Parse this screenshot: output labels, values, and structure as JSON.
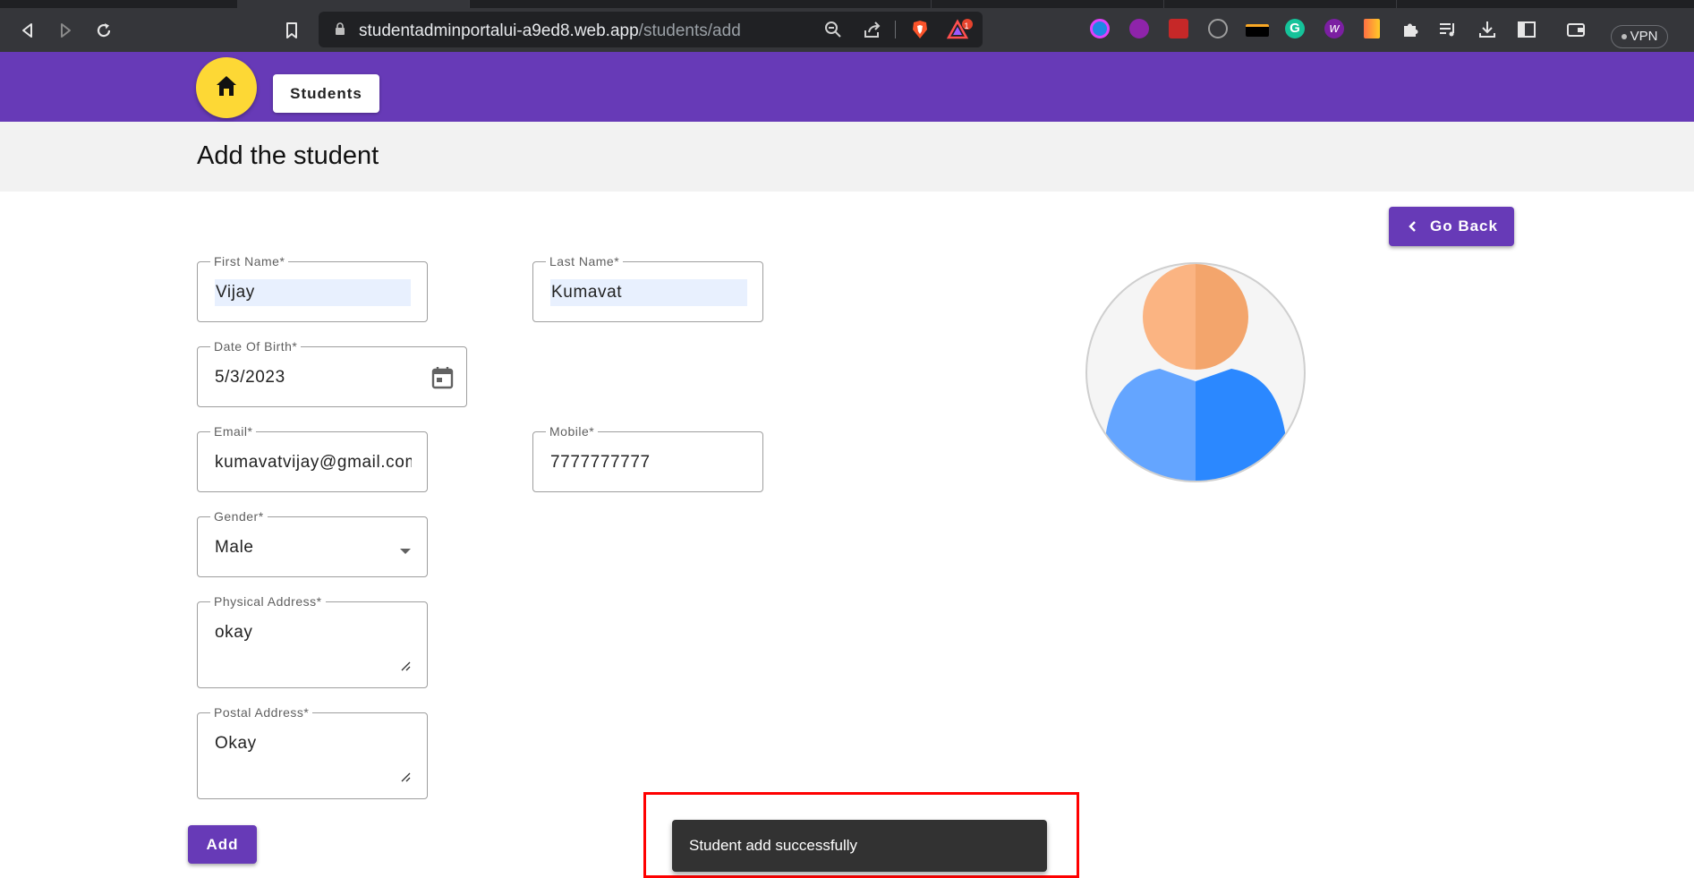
{
  "browser": {
    "url_host": "studentadminportalui-a9ed8.web.app",
    "url_path": "/students/add",
    "notification_count": "1",
    "vpn_label": "VPN"
  },
  "header": {
    "students_label": "Students"
  },
  "page": {
    "title": "Add the student",
    "go_back_label": "Go Back",
    "add_label": "Add"
  },
  "form": {
    "first_name": {
      "label": "First Name*",
      "value": "Vijay"
    },
    "last_name": {
      "label": "Last Name*",
      "value": "Kumavat"
    },
    "dob": {
      "label": "Date Of Birth*",
      "value": "5/3/2023"
    },
    "email": {
      "label": "Email*",
      "value": "kumavatvijay@gmail.com"
    },
    "mobile": {
      "label": "Mobile*",
      "value": "7777777777"
    },
    "gender": {
      "label": "Gender*",
      "value": "Male"
    },
    "physical_address": {
      "label": "Physical Address*",
      "value": "okay"
    },
    "postal_address": {
      "label": "Postal Address*",
      "value": "Okay"
    }
  },
  "snackbar": {
    "message": "Student add successfully"
  },
  "colors": {
    "primary": "#673ab7",
    "home_button": "#fdd835",
    "snackbar": "#323232",
    "highlight": "#ff0000"
  }
}
